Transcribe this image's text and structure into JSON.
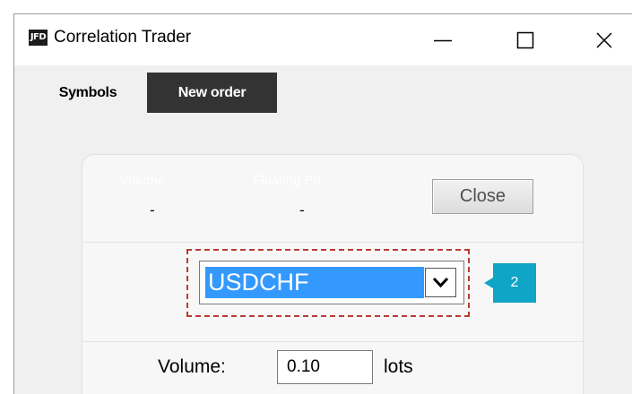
{
  "window": {
    "app_icon_text": "JFD",
    "title": "Correlation Trader"
  },
  "tabs": [
    {
      "label": "Symbols",
      "active": false
    },
    {
      "label": "New order",
      "active": true
    }
  ],
  "positions": {
    "volume_header": "Volume",
    "floating_pl_header": "Floating P/L",
    "volume_value": "-",
    "floating_pl_value": "-",
    "close_label": "Close"
  },
  "symbol_select": {
    "selected": "USDCHF"
  },
  "callout": {
    "number": "2",
    "color": "#0ea5c6"
  },
  "highlight_color": "#b83c35",
  "order": {
    "volume_label": "Volume:",
    "volume_value": "0.10",
    "volume_unit": "lots"
  },
  "icons": {
    "minimize": "minimize-icon",
    "maximize": "maximize-icon",
    "close": "close-icon",
    "dropdown": "chevron-down-icon"
  }
}
